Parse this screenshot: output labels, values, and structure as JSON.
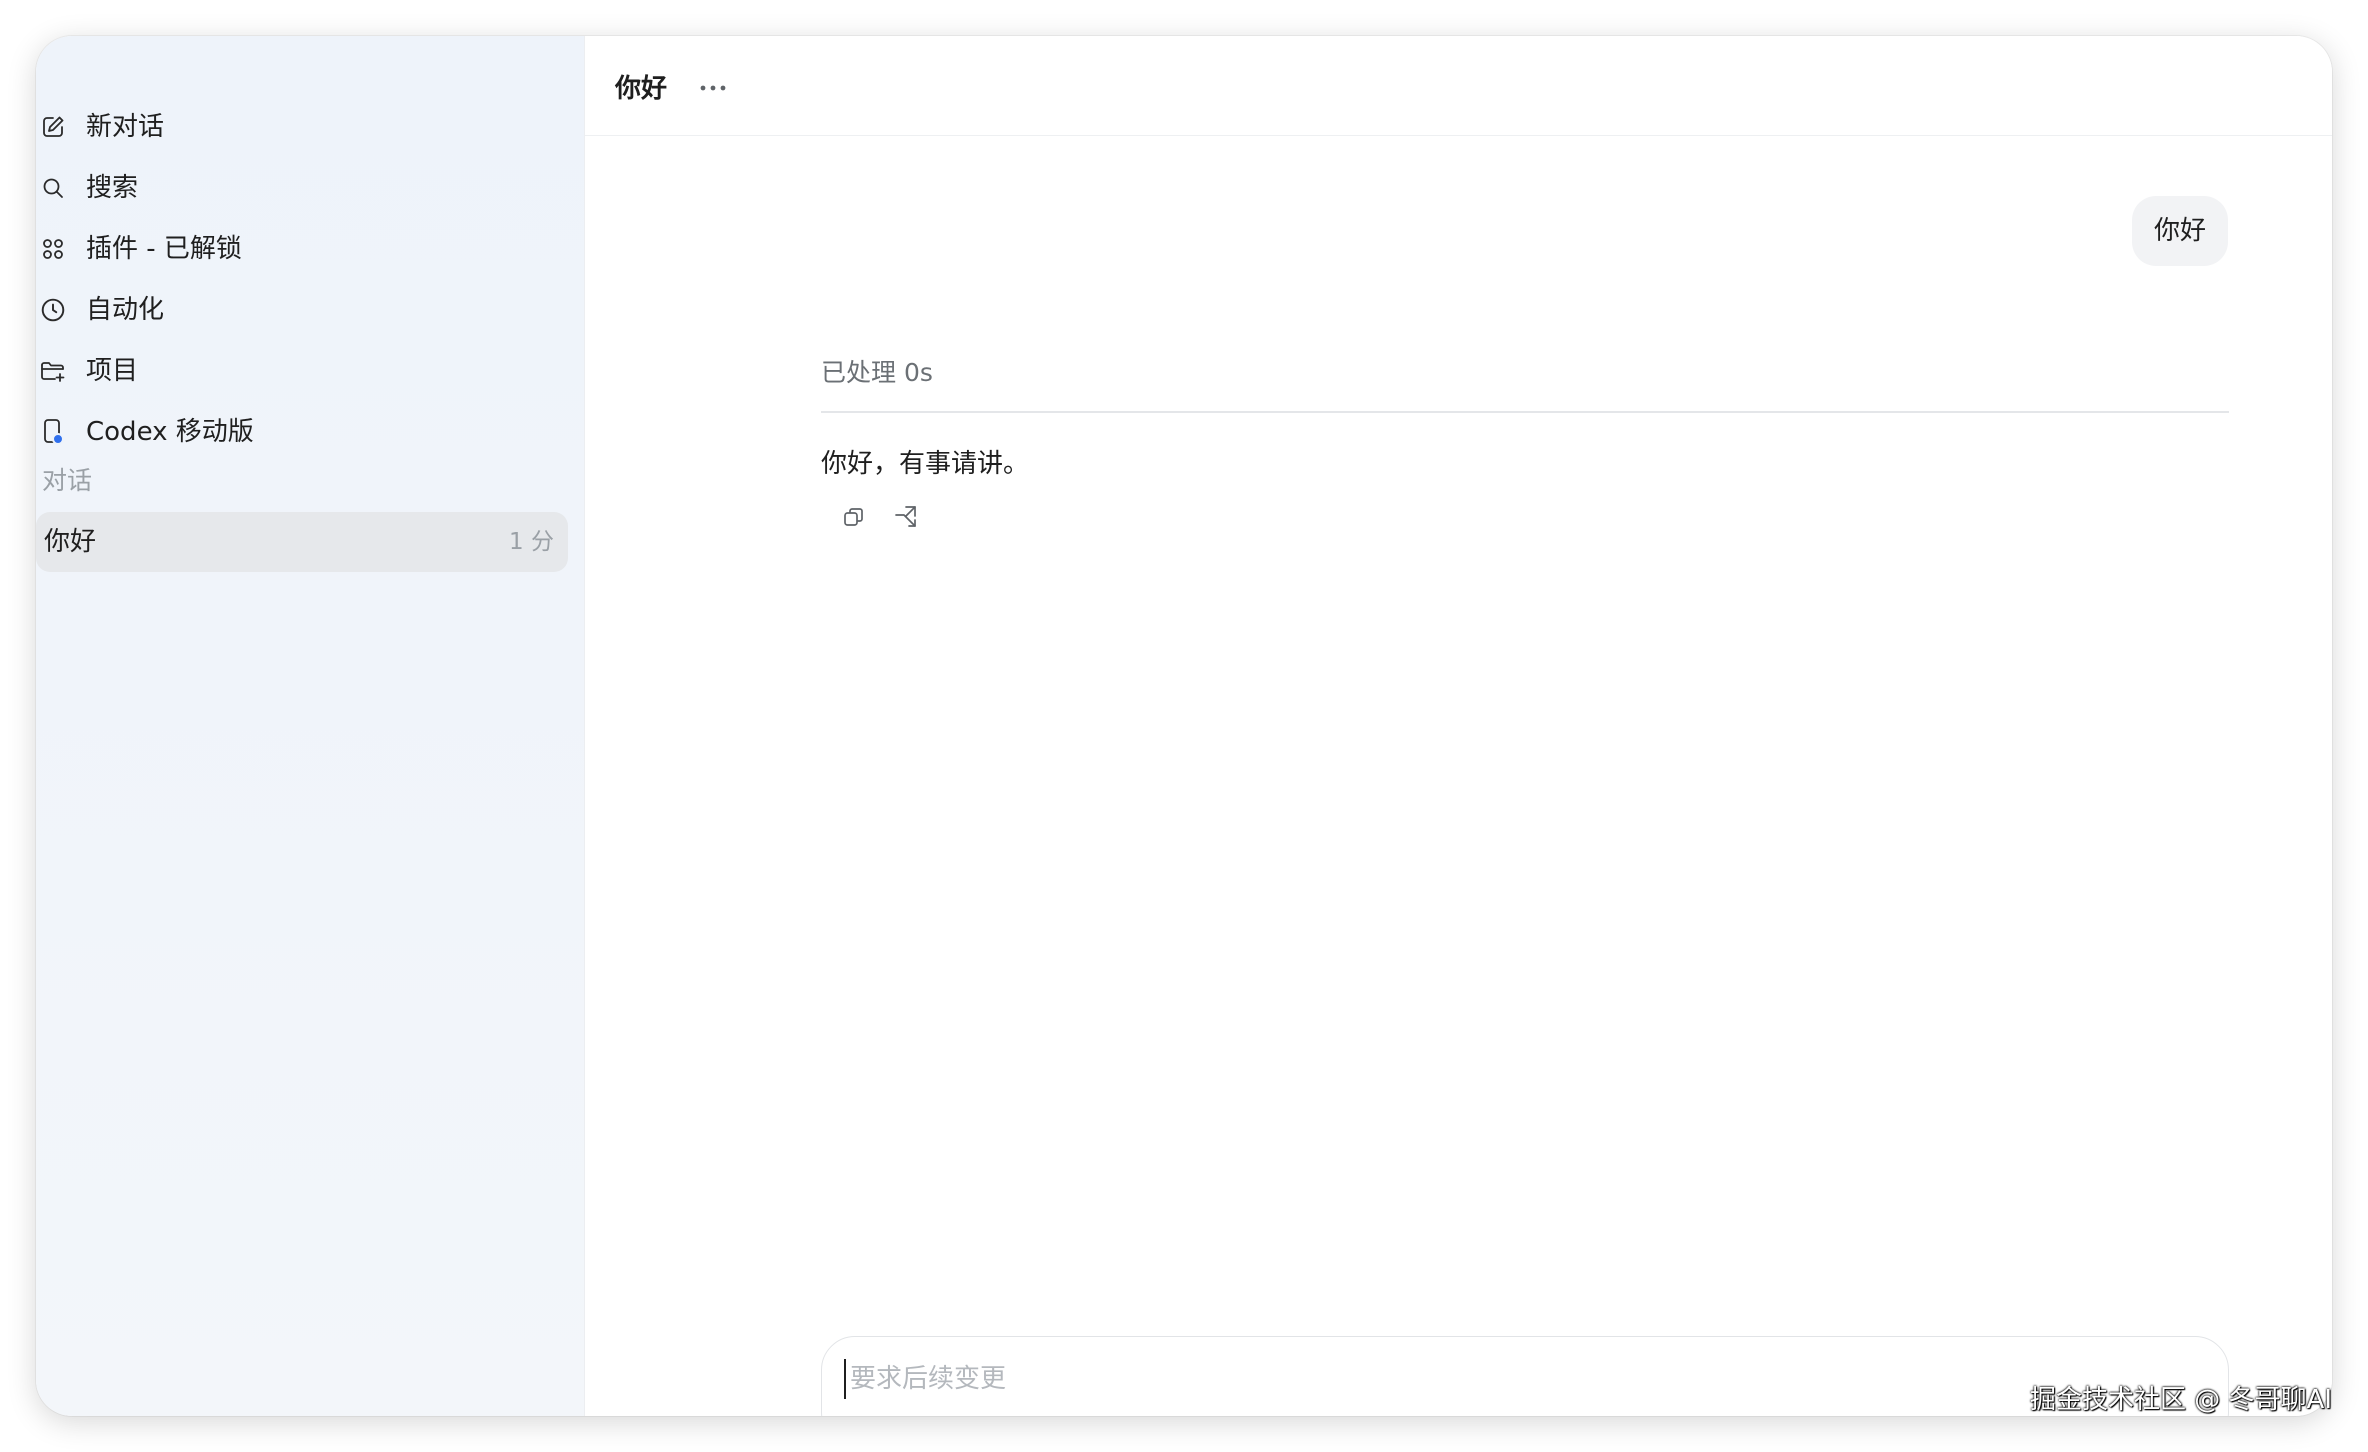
{
  "sidebar": {
    "nav_items": [
      {
        "label": "新对话",
        "icon": "edit-icon"
      },
      {
        "label": "搜索",
        "icon": "search-icon"
      },
      {
        "label": "插件 - 已解锁",
        "icon": "plugins-grid-icon"
      },
      {
        "label": "自动化",
        "icon": "clock-icon"
      },
      {
        "label": "项目",
        "icon": "folder-plus-icon"
      },
      {
        "label": "Codex 移动版",
        "icon": "mobile-icon"
      }
    ],
    "section_label": "对话",
    "conversations": [
      {
        "title": "你好",
        "time": "1 分"
      }
    ]
  },
  "header": {
    "title": "你好",
    "more_icon": "ellipsis-icon"
  },
  "messages": {
    "user": "你好",
    "processed": "已处理 0s",
    "assistant": "你好，有事请讲。"
  },
  "composer": {
    "placeholder": "要求后续变更"
  },
  "watermark": "掘金技术社区 @ 冬哥聊AI",
  "colors": {
    "sidebar_bg": "#eef3fa",
    "active_item_bg": "#e6e8eb",
    "bubble_bg": "#f2f3f5",
    "mobile_dot": "#2f6fed"
  }
}
